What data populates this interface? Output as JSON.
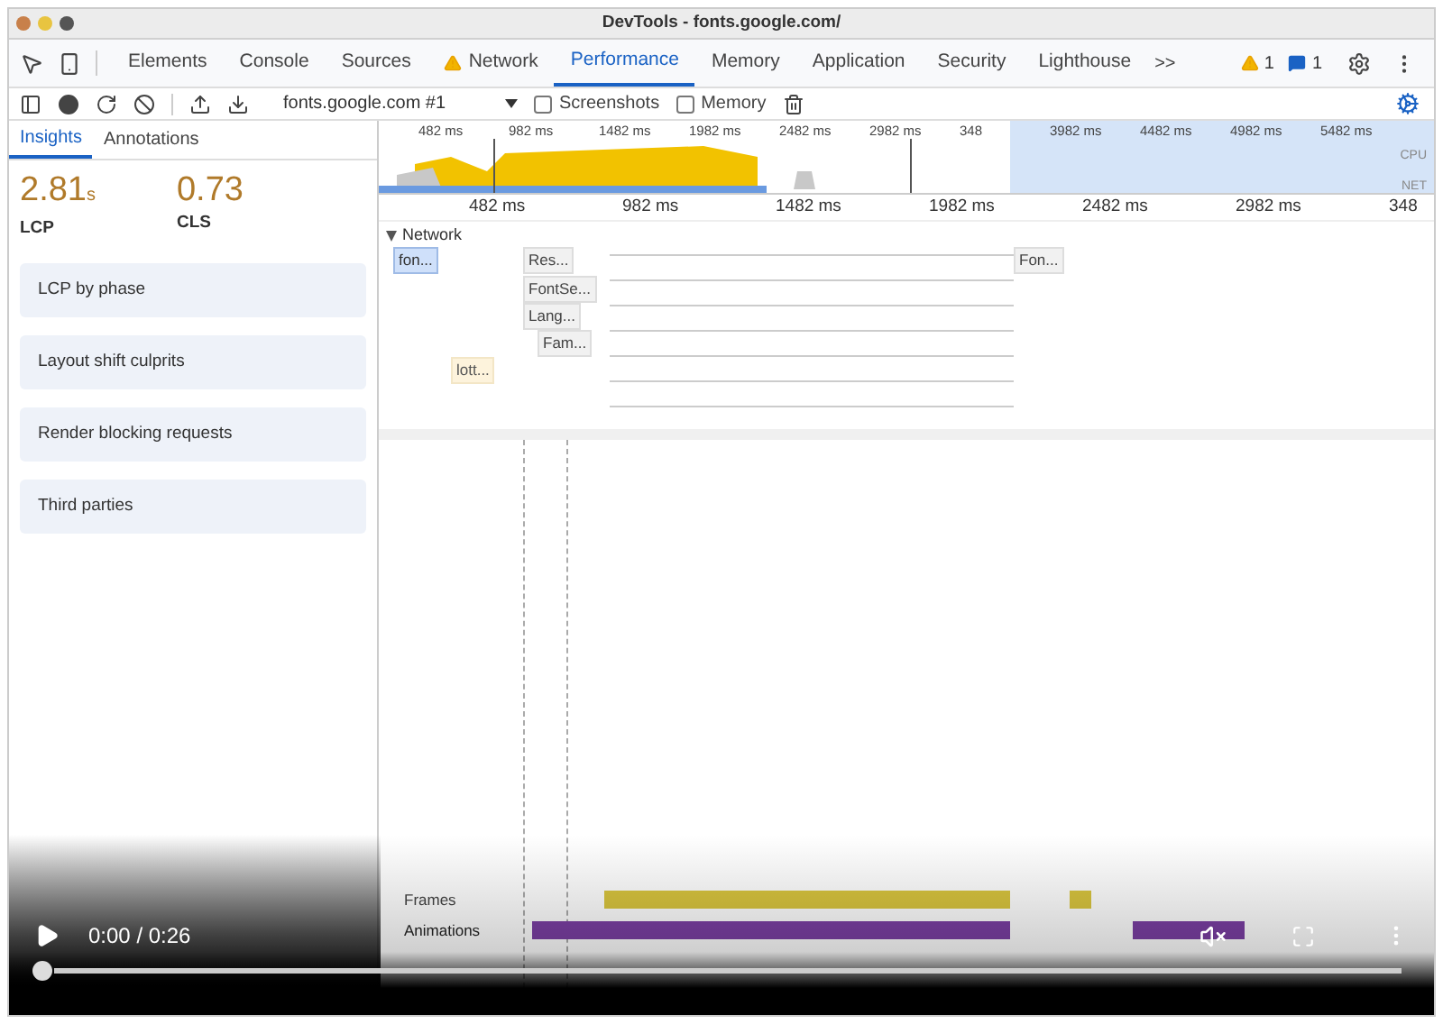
{
  "window": {
    "title": "DevTools - fonts.google.com/"
  },
  "tabs": [
    {
      "label": "Elements",
      "selected": false,
      "kind": "plain"
    },
    {
      "label": "Console",
      "selected": false,
      "kind": "plain"
    },
    {
      "label": "Sources",
      "selected": false,
      "kind": "plain"
    },
    {
      "label": "Network",
      "selected": false,
      "kind": "warning"
    },
    {
      "label": "Performance",
      "selected": true,
      "kind": "plain"
    },
    {
      "label": "Memory",
      "selected": false,
      "kind": "plain"
    },
    {
      "label": "Application",
      "selected": false,
      "kind": "plain"
    },
    {
      "label": "Security",
      "selected": false,
      "kind": "plain"
    },
    {
      "label": "Lighthouse",
      "selected": false,
      "kind": "plain"
    }
  ],
  "more_tabs": ">>",
  "issue_counts": {
    "warnings": "1",
    "messages": "1"
  },
  "toolbar": {
    "recording": "fonts.google.com #1",
    "checkboxes": [
      {
        "label": "Screenshots",
        "checked": false
      },
      {
        "label": "Memory",
        "checked": false
      }
    ]
  },
  "overview": {
    "ticks": [
      "482 ms",
      "982 ms",
      "1482 ms",
      "1982 ms",
      "2482 ms",
      "2982 ms",
      "348",
      "3982 ms",
      "4482 ms",
      "4982 ms",
      "5482 ms"
    ],
    "tracks": [
      "CPU",
      "NET"
    ]
  },
  "sidebar": {
    "tabs": [
      {
        "label": "Insights",
        "selected": true
      },
      {
        "label": "Annotations",
        "selected": false
      }
    ],
    "metrics": [
      {
        "value": "2.81",
        "unit": "s",
        "label": "LCP"
      },
      {
        "value": "0.73",
        "label": "CLS"
      }
    ],
    "insights": [
      "LCP by phase",
      "Layout shift culprits",
      "Render blocking requests",
      "Third parties"
    ]
  },
  "timeline": {
    "ticks": [
      "482 ms",
      "982 ms",
      "1482 ms",
      "1982 ms",
      "2482 ms",
      "2982 ms",
      "348"
    ],
    "network": {
      "label": "Network",
      "expanded": true,
      "requests": [
        {
          "label": "fon...",
          "selected": true
        },
        {
          "label": "Res...",
          "selected": false
        },
        {
          "label": "FontSe...",
          "selected": false
        },
        {
          "label": "Lang...",
          "selected": false
        },
        {
          "label": "Fam...",
          "selected": false
        },
        {
          "label": "lott...",
          "selected": false
        },
        {
          "label": "Fon...",
          "selected": false
        }
      ]
    },
    "tracks": [
      "Frames",
      "Animations"
    ]
  },
  "video": {
    "time": "0:00 / 0:26",
    "level": 0,
    "muted": true
  }
}
